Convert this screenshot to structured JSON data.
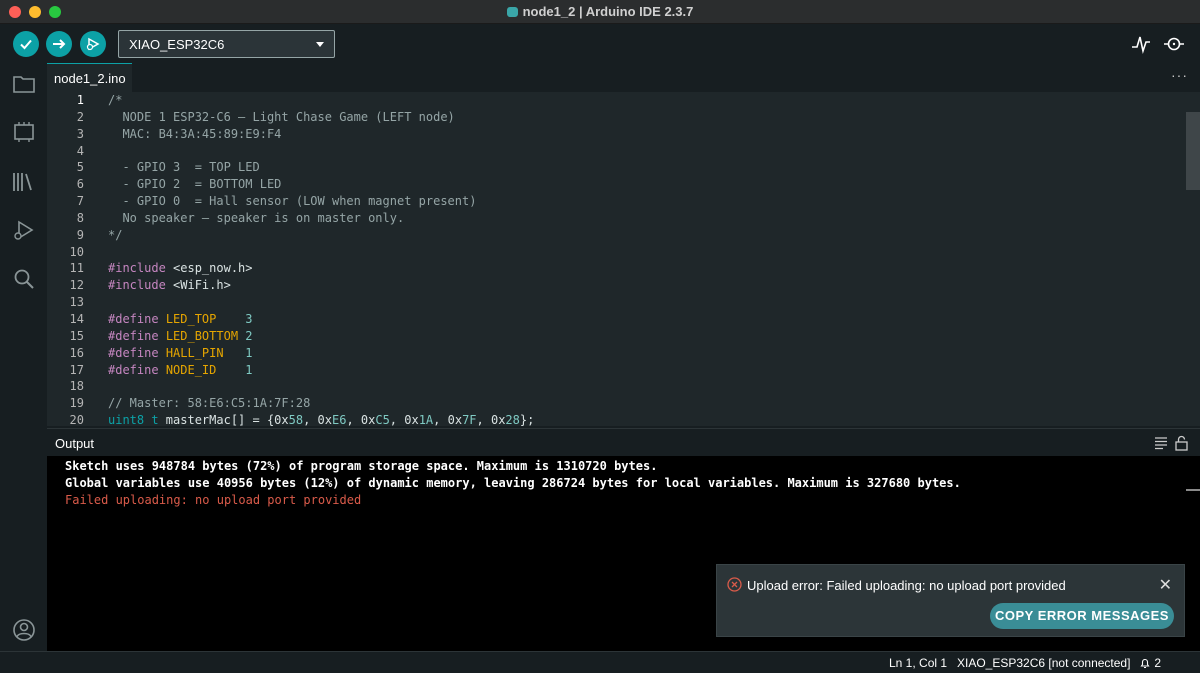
{
  "window": {
    "title": "node1_2 | Arduino IDE 2.3.7"
  },
  "toolbar": {
    "board": "XIAO_ESP32C6",
    "verify_icon": "checkmark-icon",
    "upload_icon": "arrow-right-icon",
    "debug_icon": "debugger-icon",
    "serial_plotter_icon": "serial-plotter-icon",
    "serial_monitor_icon": "serial-monitor-icon"
  },
  "tabs": [
    {
      "label": "node1_2.ino"
    }
  ],
  "tab_more": "···",
  "editor": {
    "line_numbers": [
      "1",
      "2",
      "3",
      "4",
      "5",
      "6",
      "7",
      "8",
      "9",
      "10",
      "11",
      "12",
      "13",
      "14",
      "15",
      "16",
      "17",
      "18",
      "19",
      "20"
    ]
  },
  "output": {
    "title": "Output",
    "lines": [
      "Sketch uses 948784 bytes (72%) of program storage space. Maximum is 1310720 bytes.",
      "Global variables use 40956 bytes (12%) of dynamic memory, leaving 286724 bytes for local variables. Maximum is 327680 bytes.",
      "Failed uploading: no upload port provided"
    ]
  },
  "notification": {
    "message": "Upload error: Failed uploading: no upload port provided",
    "button": "COPY ERROR MESSAGES",
    "close": "✕"
  },
  "statusbar": {
    "position": "Ln 1, Col 1",
    "board": "XIAO_ESP32C6 [not connected]",
    "notifications": "2"
  },
  "colors": {
    "accent": "#0ca1a6",
    "error": "#da5b4a"
  }
}
